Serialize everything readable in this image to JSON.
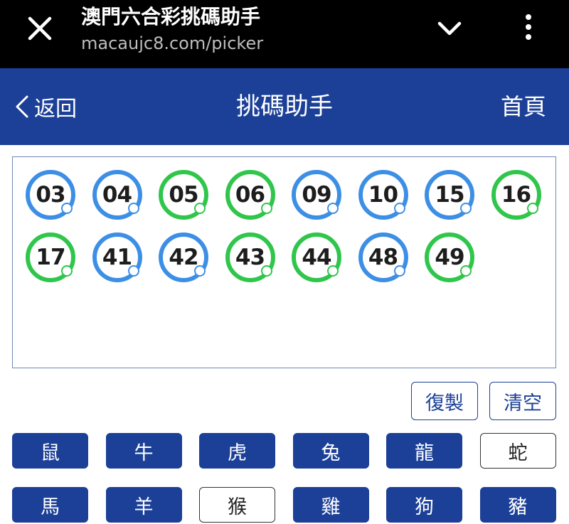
{
  "browser": {
    "page_title": "澳門六合彩挑碼助手",
    "url": "macaujc8.com/picker",
    "close_icon": "close-icon",
    "chevron_icon": "chevron-down-icon",
    "menu_icon": "more-vert-icon"
  },
  "header": {
    "back_label": "返回",
    "title": "挑碼助手",
    "home_label": "首頁",
    "color": "#1c4097"
  },
  "balls": [
    {
      "num": "03",
      "color": "blue"
    },
    {
      "num": "04",
      "color": "blue"
    },
    {
      "num": "05",
      "color": "green"
    },
    {
      "num": "06",
      "color": "green"
    },
    {
      "num": "09",
      "color": "blue"
    },
    {
      "num": "10",
      "color": "blue"
    },
    {
      "num": "15",
      "color": "blue"
    },
    {
      "num": "16",
      "color": "green"
    },
    {
      "num": "17",
      "color": "green"
    },
    {
      "num": "41",
      "color": "blue"
    },
    {
      "num": "42",
      "color": "blue"
    },
    {
      "num": "43",
      "color": "green"
    },
    {
      "num": "44",
      "color": "green"
    },
    {
      "num": "48",
      "color": "blue"
    },
    {
      "num": "49",
      "color": "green"
    }
  ],
  "actions": {
    "copy_label": "復製",
    "clear_label": "清空"
  },
  "zodiac": [
    {
      "label": "鼠",
      "selected": true
    },
    {
      "label": "牛",
      "selected": true
    },
    {
      "label": "虎",
      "selected": true
    },
    {
      "label": "兔",
      "selected": true
    },
    {
      "label": "龍",
      "selected": true
    },
    {
      "label": "蛇",
      "selected": false
    },
    {
      "label": "馬",
      "selected": true
    },
    {
      "label": "羊",
      "selected": true
    },
    {
      "label": "猴",
      "selected": false
    },
    {
      "label": "雞",
      "selected": true
    },
    {
      "label": "狗",
      "selected": true
    },
    {
      "label": "豬",
      "selected": true
    }
  ],
  "colors": {
    "blue_ball": "#3d8fe6",
    "green_ball": "#2fc64b",
    "accent": "#1c4097"
  }
}
